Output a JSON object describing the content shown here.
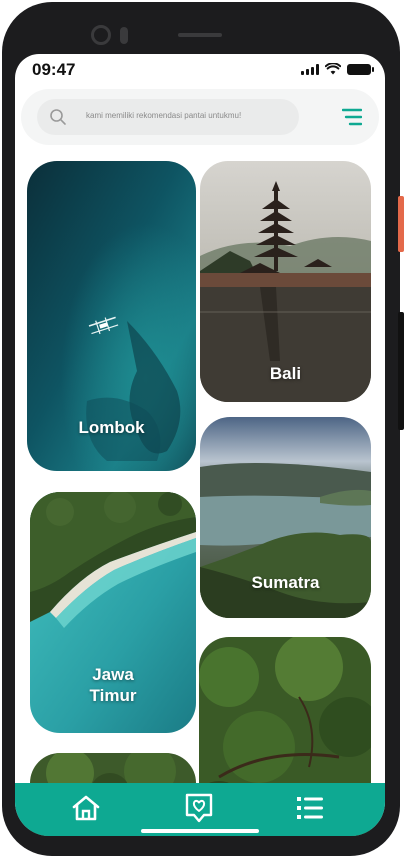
{
  "status_bar": {
    "time": "09:47"
  },
  "search": {
    "placeholder": "kami memiliki rekomendasi pantai untukmu!"
  },
  "destinations": [
    {
      "label": "Lombok"
    },
    {
      "label": "Bali"
    },
    {
      "label": "Sumatra"
    },
    {
      "label_line1": "Jawa",
      "label_line2": "Timur"
    }
  ],
  "icons": {
    "search": "search-icon",
    "menu": "menu-icon",
    "home": "home-icon",
    "favorites": "heart-chat-icon",
    "list": "list-icon"
  },
  "colors": {
    "accent": "#0ea992"
  }
}
